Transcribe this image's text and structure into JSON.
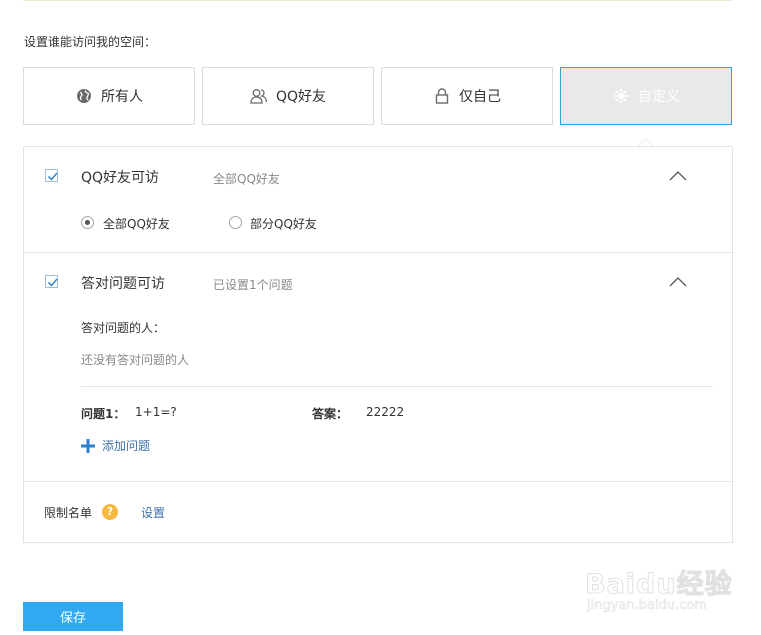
{
  "prompt": "设置谁能访问我的空间：",
  "options": [
    {
      "label": "所有人",
      "icon": "globe-icon"
    },
    {
      "label": "QQ好友",
      "icon": "friends-icon"
    },
    {
      "label": "仅自己",
      "icon": "lock-icon"
    },
    {
      "label": "自定义",
      "icon": "gear-icon",
      "selected": true
    }
  ],
  "qq_friends": {
    "title": "QQ好友可访",
    "subtitle": "全部QQ好友",
    "checked": true,
    "radios": [
      {
        "label": "全部QQ好友",
        "selected": true
      },
      {
        "label": "部分QQ好友",
        "selected": false
      }
    ]
  },
  "question": {
    "title": "答对问题可访",
    "subtitle": "已设置1个问题",
    "checked": true,
    "answered_label": "答对问题的人：",
    "answered_empty": "还没有答对问题的人",
    "q_label": "问题1：",
    "q_value": "1+1=?",
    "a_label": "答案：",
    "a_value": "22222",
    "add_label": "添加问题"
  },
  "blocklist": {
    "label": "限制名单",
    "help": "?",
    "link": "设置"
  },
  "save_label": "保存",
  "watermark": {
    "main": "Baidu经验",
    "sub": "jingyan.baidu.com"
  },
  "colors": {
    "accent": "#2fa9f1",
    "selected_border": "#2da7e0",
    "link": "#3d6fa8",
    "help_badge": "#f5b940"
  }
}
